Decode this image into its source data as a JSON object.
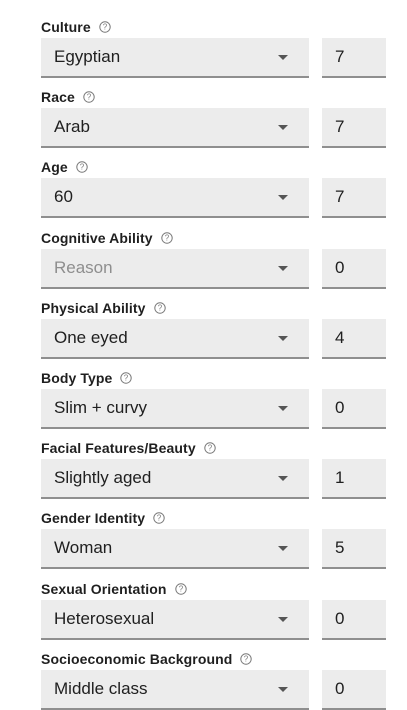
{
  "fields": [
    {
      "label": "Culture",
      "value": "Egyptian",
      "is_placeholder": false,
      "weight": "7"
    },
    {
      "label": "Race",
      "value": "Arab",
      "is_placeholder": false,
      "weight": "7"
    },
    {
      "label": "Age",
      "value": "60",
      "is_placeholder": false,
      "weight": "7"
    },
    {
      "label": "Cognitive Ability",
      "value": "Reason",
      "is_placeholder": true,
      "weight": "0"
    },
    {
      "label": "Physical Ability",
      "value": "One eyed",
      "is_placeholder": false,
      "weight": "4"
    },
    {
      "label": "Body Type",
      "value": "Slim + curvy",
      "is_placeholder": false,
      "weight": "0"
    },
    {
      "label": "Facial Features/Beauty",
      "value": "Slightly aged",
      "is_placeholder": false,
      "weight": "1"
    },
    {
      "label": "Gender Identity",
      "value": "Woman",
      "is_placeholder": false,
      "weight": "5"
    },
    {
      "label": "Sexual Orientation",
      "value": "Heterosexual",
      "is_placeholder": false,
      "weight": "0"
    },
    {
      "label": "Socioeconomic Background",
      "value": "Middle class",
      "is_placeholder": false,
      "weight": "0"
    }
  ],
  "icons": {
    "help": "help-circle-icon",
    "dropdown": "dropdown-arrow-icon"
  },
  "colors": {
    "field_background": "#ececec",
    "underline": "#8f8f8f",
    "placeholder_text": "#8e8e8e"
  }
}
